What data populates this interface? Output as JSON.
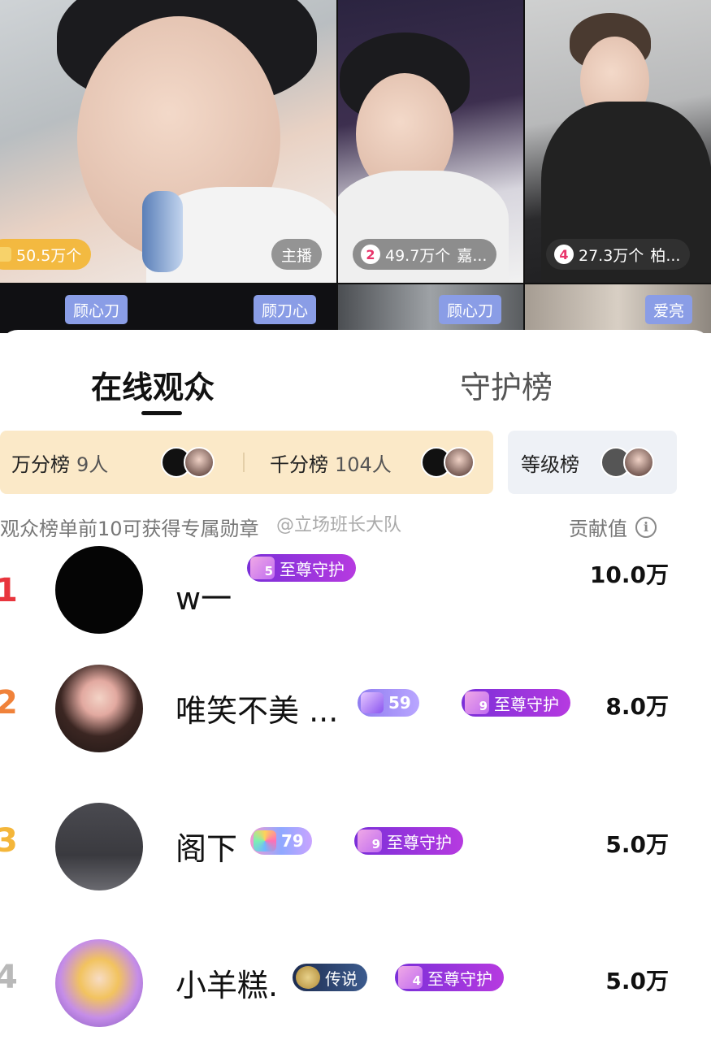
{
  "streams": [
    {
      "gift_amount": "50.5万个",
      "host_label": "主播",
      "name_left": "顾心刀",
      "name_right": "顾刀心"
    },
    {
      "rank": "2",
      "gift_amount": "49.7万个",
      "gift_name": "嘉...",
      "name": "顾心刀"
    },
    {
      "rank": "4",
      "gift_amount": "27.3万个",
      "gift_name": "柏...",
      "name": "爱亮"
    }
  ],
  "tabs": {
    "active": "在线观众",
    "inactive": "守护榜"
  },
  "rank_boxes": {
    "wanfen": {
      "label": "万分榜",
      "count": "9人"
    },
    "qianfen": {
      "label": "千分榜",
      "count": "104人"
    },
    "dengji": {
      "label": "等级榜"
    }
  },
  "hint": "观众榜单前10可获得专属勋章",
  "watermark": "@立场班长大队",
  "contribution_label": "贡献值",
  "colors": {
    "guard_badge": "#8b35dc",
    "name_tag": "#8a9de6",
    "rank_box_gold": "#fbe9c8",
    "rank1": "#e8353d",
    "rank2": "#f0823a",
    "rank3": "#f4b63a",
    "rank4": "#b9b9b9"
  },
  "viewers": [
    {
      "rank": "1",
      "name": "w一",
      "guard_level": "5",
      "guard_label": "至尊守护",
      "value": "10.0万"
    },
    {
      "rank": "2",
      "name": "唯笑不美 ...",
      "user_level": "59",
      "guard_level": "9",
      "guard_label": "至尊守护",
      "value": "8.0万"
    },
    {
      "rank": "3",
      "name": "阁下",
      "user_level": "79",
      "guard_level": "9",
      "guard_label": "至尊守护",
      "value": "5.0万"
    },
    {
      "rank": "4",
      "name": "小羊糕.",
      "legend_label": "传说",
      "guard_level": "4",
      "guard_label": "至尊守护",
      "value": "5.0万"
    }
  ]
}
